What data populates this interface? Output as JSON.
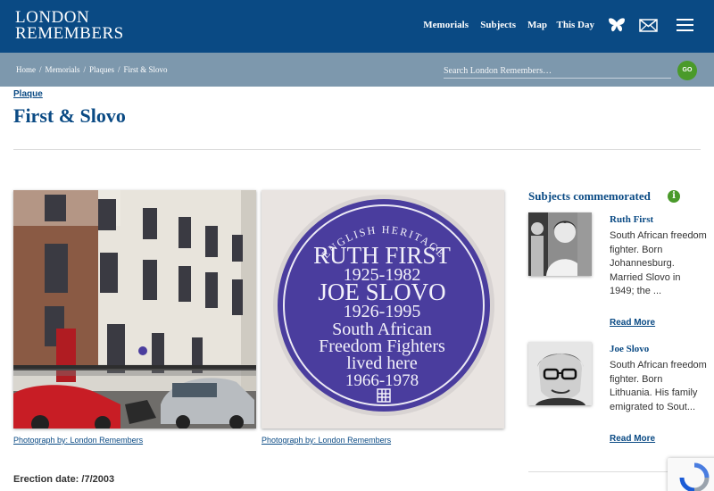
{
  "brand": {
    "line1": "LONDON",
    "line2": "REMEMBERS"
  },
  "nav": {
    "memorials": "Memorials",
    "subjects": "Subjects",
    "map": "Map",
    "this_day": "This Day"
  },
  "breadcrumb": {
    "home": "Home",
    "memorials": "Memorials",
    "plaques": "Plaques",
    "current": "First & Slovo",
    "separator": "/"
  },
  "search": {
    "placeholder": "Search London Remembers…",
    "go_label": "GO"
  },
  "page": {
    "type": "Plaque",
    "title": "First & Slovo"
  },
  "plaque_text": {
    "header": "ENGLISH HERITAGE",
    "line1": "RUTH FIRST",
    "line2": "1925-1982",
    "line3": "JOE SLOVO",
    "line4": "1926-1995",
    "line5": "South African",
    "line6": "Freedom Fighters",
    "line7": "lived here",
    "line8": "1966-1978"
  },
  "photos": [
    {
      "caption": "Photograph by: London Remembers"
    },
    {
      "caption": "Photograph by: London Remembers"
    }
  ],
  "details": {
    "erection_date": "Erection date: /7/2003"
  },
  "sidebar": {
    "title": "Subjects commemorated",
    "info_icon": "i",
    "subjects": [
      {
        "name": "Ruth First",
        "description": "South African freedom fighter. Born Johannesburg. Married Slovo in 1949; the ...",
        "read_more": "Read More"
      },
      {
        "name": "Joe Slovo",
        "description": "South African freedom fighter. Born Lithuania. His family emigrated to Sout...",
        "read_more": "Read More"
      }
    ]
  },
  "colors": {
    "brand_blue": "#0a4a84",
    "crumb_bar": "#7d98ad",
    "accent_green": "#4a9a2a",
    "plaque_blue": "#4a3d9e"
  },
  "icons": [
    "butterfly-icon",
    "envelope-icon",
    "hamburger-menu-icon",
    "info-icon",
    "recaptcha-icon"
  ]
}
